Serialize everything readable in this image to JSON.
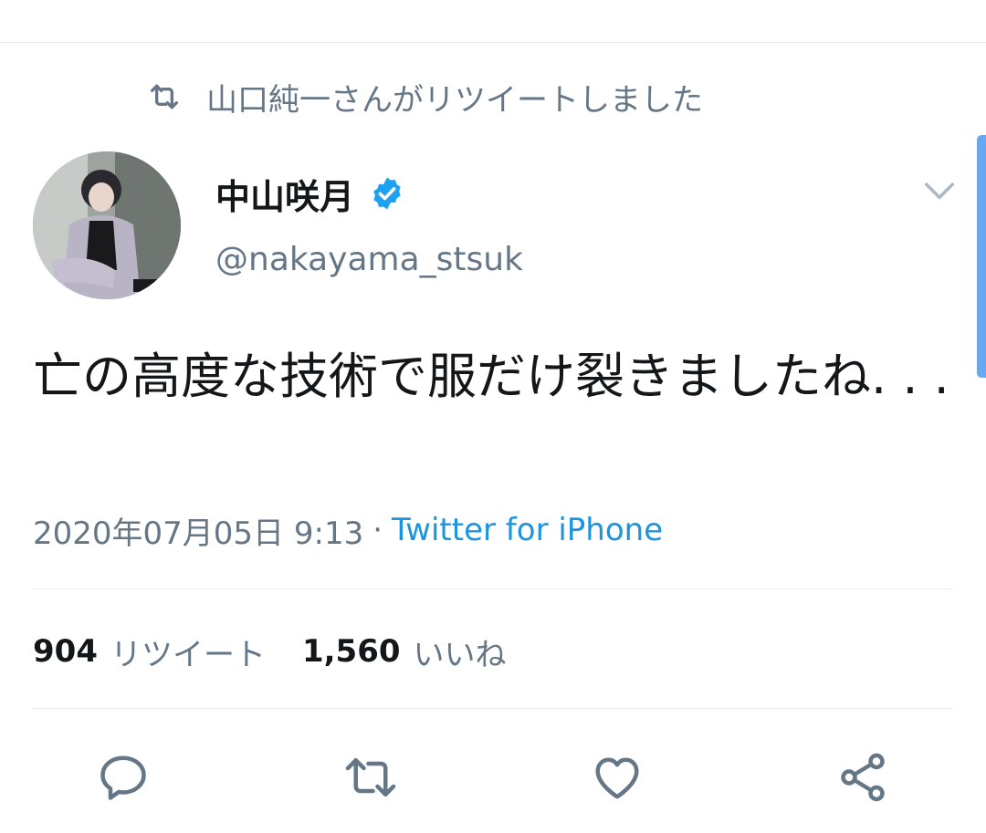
{
  "retweet_context": {
    "text": "山口純一さんがリツイートしました",
    "icon": "retweet-icon"
  },
  "author": {
    "display_name": "中山咲月",
    "handle": "@nakayama_stsuk",
    "verified": true
  },
  "tweet": {
    "text": "亡の高度な技術で服だけ裂きましたね. . .",
    "timestamp": "2020年07月05日 9:13",
    "separator": "·",
    "source": "Twitter for iPhone"
  },
  "stats": {
    "retweets_count": "904",
    "retweets_label": "リツイート",
    "likes_count": "1,560",
    "likes_label": "いいね"
  },
  "actions": [
    "reply-icon",
    "retweet-icon",
    "like-icon",
    "share-icon"
  ],
  "colors": {
    "accent": "#1b95e0",
    "verified": "#1da1f2",
    "secondary_text": "#657786",
    "icon_gray": "#657786"
  }
}
